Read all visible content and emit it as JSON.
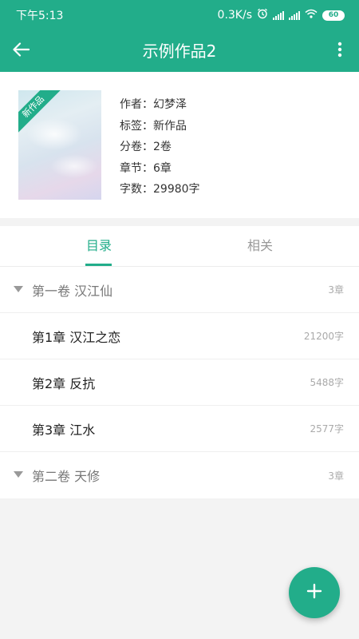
{
  "status_bar": {
    "time": "下午5:13",
    "network_speed": "0.3K/s",
    "battery_level": "60",
    "icons": [
      "alarm-icon",
      "signal-icon",
      "signal-icon",
      "wifi-icon",
      "battery-icon"
    ]
  },
  "toolbar": {
    "title": "示例作品2",
    "back_icon": "arrow-left-icon",
    "more_icon": "more-vertical-icon"
  },
  "book": {
    "badge": "新作品",
    "author_label": "作者：幻梦泽",
    "tag_label": "标签：新作品",
    "volumes_label": "分卷：2卷",
    "chapters_label": "章节：6章",
    "words_label": "字数：29980字"
  },
  "tabs": [
    {
      "label": "目录",
      "active": true
    },
    {
      "label": "相关",
      "active": false
    }
  ],
  "toc": {
    "rows": [
      {
        "type": "volume",
        "title": "第一卷 汉江仙",
        "meta": "3章"
      },
      {
        "type": "chapter",
        "title": "第1章 汉江之恋",
        "meta": "21200字"
      },
      {
        "type": "chapter",
        "title": "第2章 反抗",
        "meta": "5488字"
      },
      {
        "type": "chapter",
        "title": "第3章 江水",
        "meta": "2577字"
      },
      {
        "type": "volume",
        "title": "第二卷 天修",
        "meta": "3章"
      }
    ]
  },
  "fab": {
    "icon": "plus-icon"
  },
  "colors": {
    "accent": "#22ad8a",
    "background": "#f3f3f3",
    "text_primary": "#222222",
    "text_secondary": "#999999"
  }
}
